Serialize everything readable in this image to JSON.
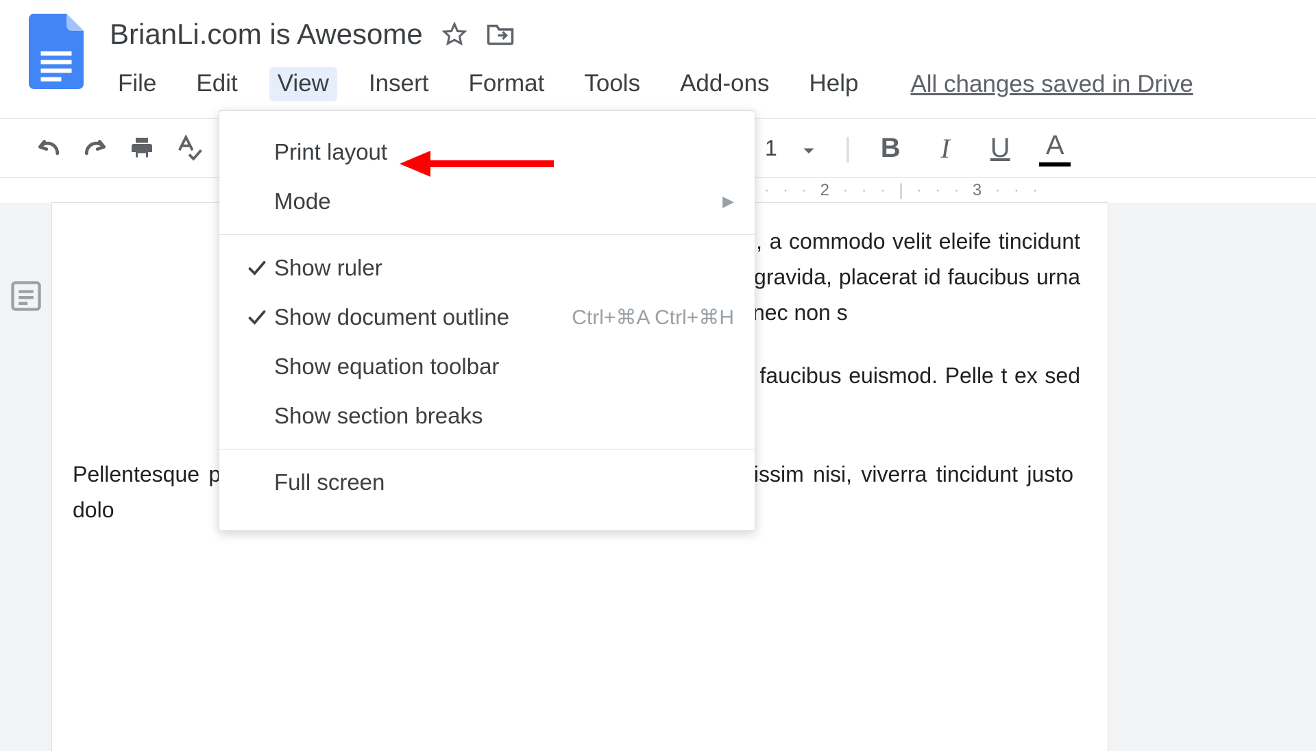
{
  "doc": {
    "title": "BrianLi.com is Awesome",
    "saved_status": "All changes saved in Drive"
  },
  "menu": {
    "file": "File",
    "edit": "Edit",
    "view": "View",
    "insert": "Insert",
    "format": "Format",
    "tools": "Tools",
    "addons": "Add-ons",
    "help": "Help"
  },
  "toolbar": {
    "font_size": "1",
    "bold": "B",
    "italic": "I",
    "underline": "U",
    "text_color": "A"
  },
  "ruler": {
    "n2": "2",
    "n3": "3"
  },
  "dropdown": {
    "print_layout": "Print layout",
    "mode": "Mode",
    "show_ruler": "Show ruler",
    "show_outline": "Show document outline",
    "show_outline_shortcut": "Ctrl+⌘A Ctrl+⌘H",
    "show_eq_toolbar": "Show equation toolbar",
    "show_section_breaks": "Show section breaks",
    "full_screen": "Full screen"
  },
  "body": {
    "p1": ". Curabitur gravida finibus m, a commodo velit eleife tincidunt nisl commodo. In ces lorem gravida, placerat id faucibus urna cursus orn nsan porttitor. Donec non s",
    "p2": "t nec sodales. Etiam ege ac faucibus euismod. Pelle t ex sed justo luctus interdu",
    "p3": "Pellentesque posuere nisi vitae dolor venenatis comn enim elit dignissim nisi, viverra tincidunt justo dolo"
  }
}
